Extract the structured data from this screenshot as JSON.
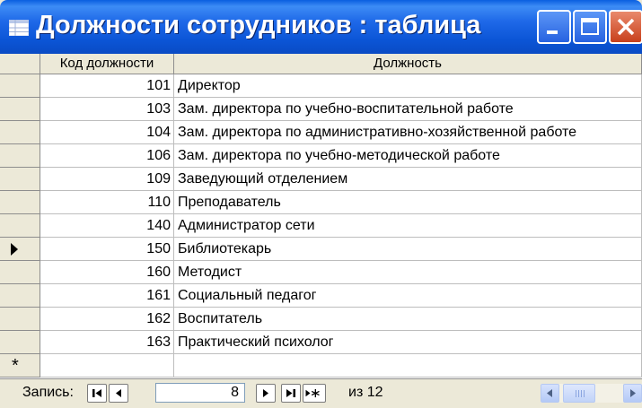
{
  "window": {
    "title": "Должности сотрудников : таблица",
    "icons": [
      "datasheet-icon",
      "minimize-icon",
      "maximize-icon",
      "close-icon"
    ]
  },
  "grid": {
    "columns": [
      "Код должности",
      "Должность"
    ],
    "rows": [
      {
        "code": "101",
        "name": "Директор"
      },
      {
        "code": "103",
        "name": "Зам. директора по учебно-воспитательной работе"
      },
      {
        "code": "104",
        "name": "Зам. директора по административно-хозяйственной работе"
      },
      {
        "code": "106",
        "name": "Зам. директора по учебно-методической работе"
      },
      {
        "code": "109",
        "name": "Заведующий отделением"
      },
      {
        "code": "110",
        "name": "Преподаватель"
      },
      {
        "code": "140",
        "name": "Администратор сети"
      },
      {
        "code": "150",
        "name": "Библиотекарь"
      },
      {
        "code": "160",
        "name": "Методист"
      },
      {
        "code": "161",
        "name": "Социальный педагог"
      },
      {
        "code": "162",
        "name": "Воспитатель"
      },
      {
        "code": "163",
        "name": "Практический психолог"
      }
    ],
    "current_row_index": 7,
    "new_record_marker": "*"
  },
  "navigation": {
    "label": "Запись:",
    "current_record": "8",
    "total_text": "из 12"
  },
  "colors": {
    "titlebar": "#0a5fe0",
    "close_button": "#c8401c",
    "chrome": "#ece9d8"
  }
}
